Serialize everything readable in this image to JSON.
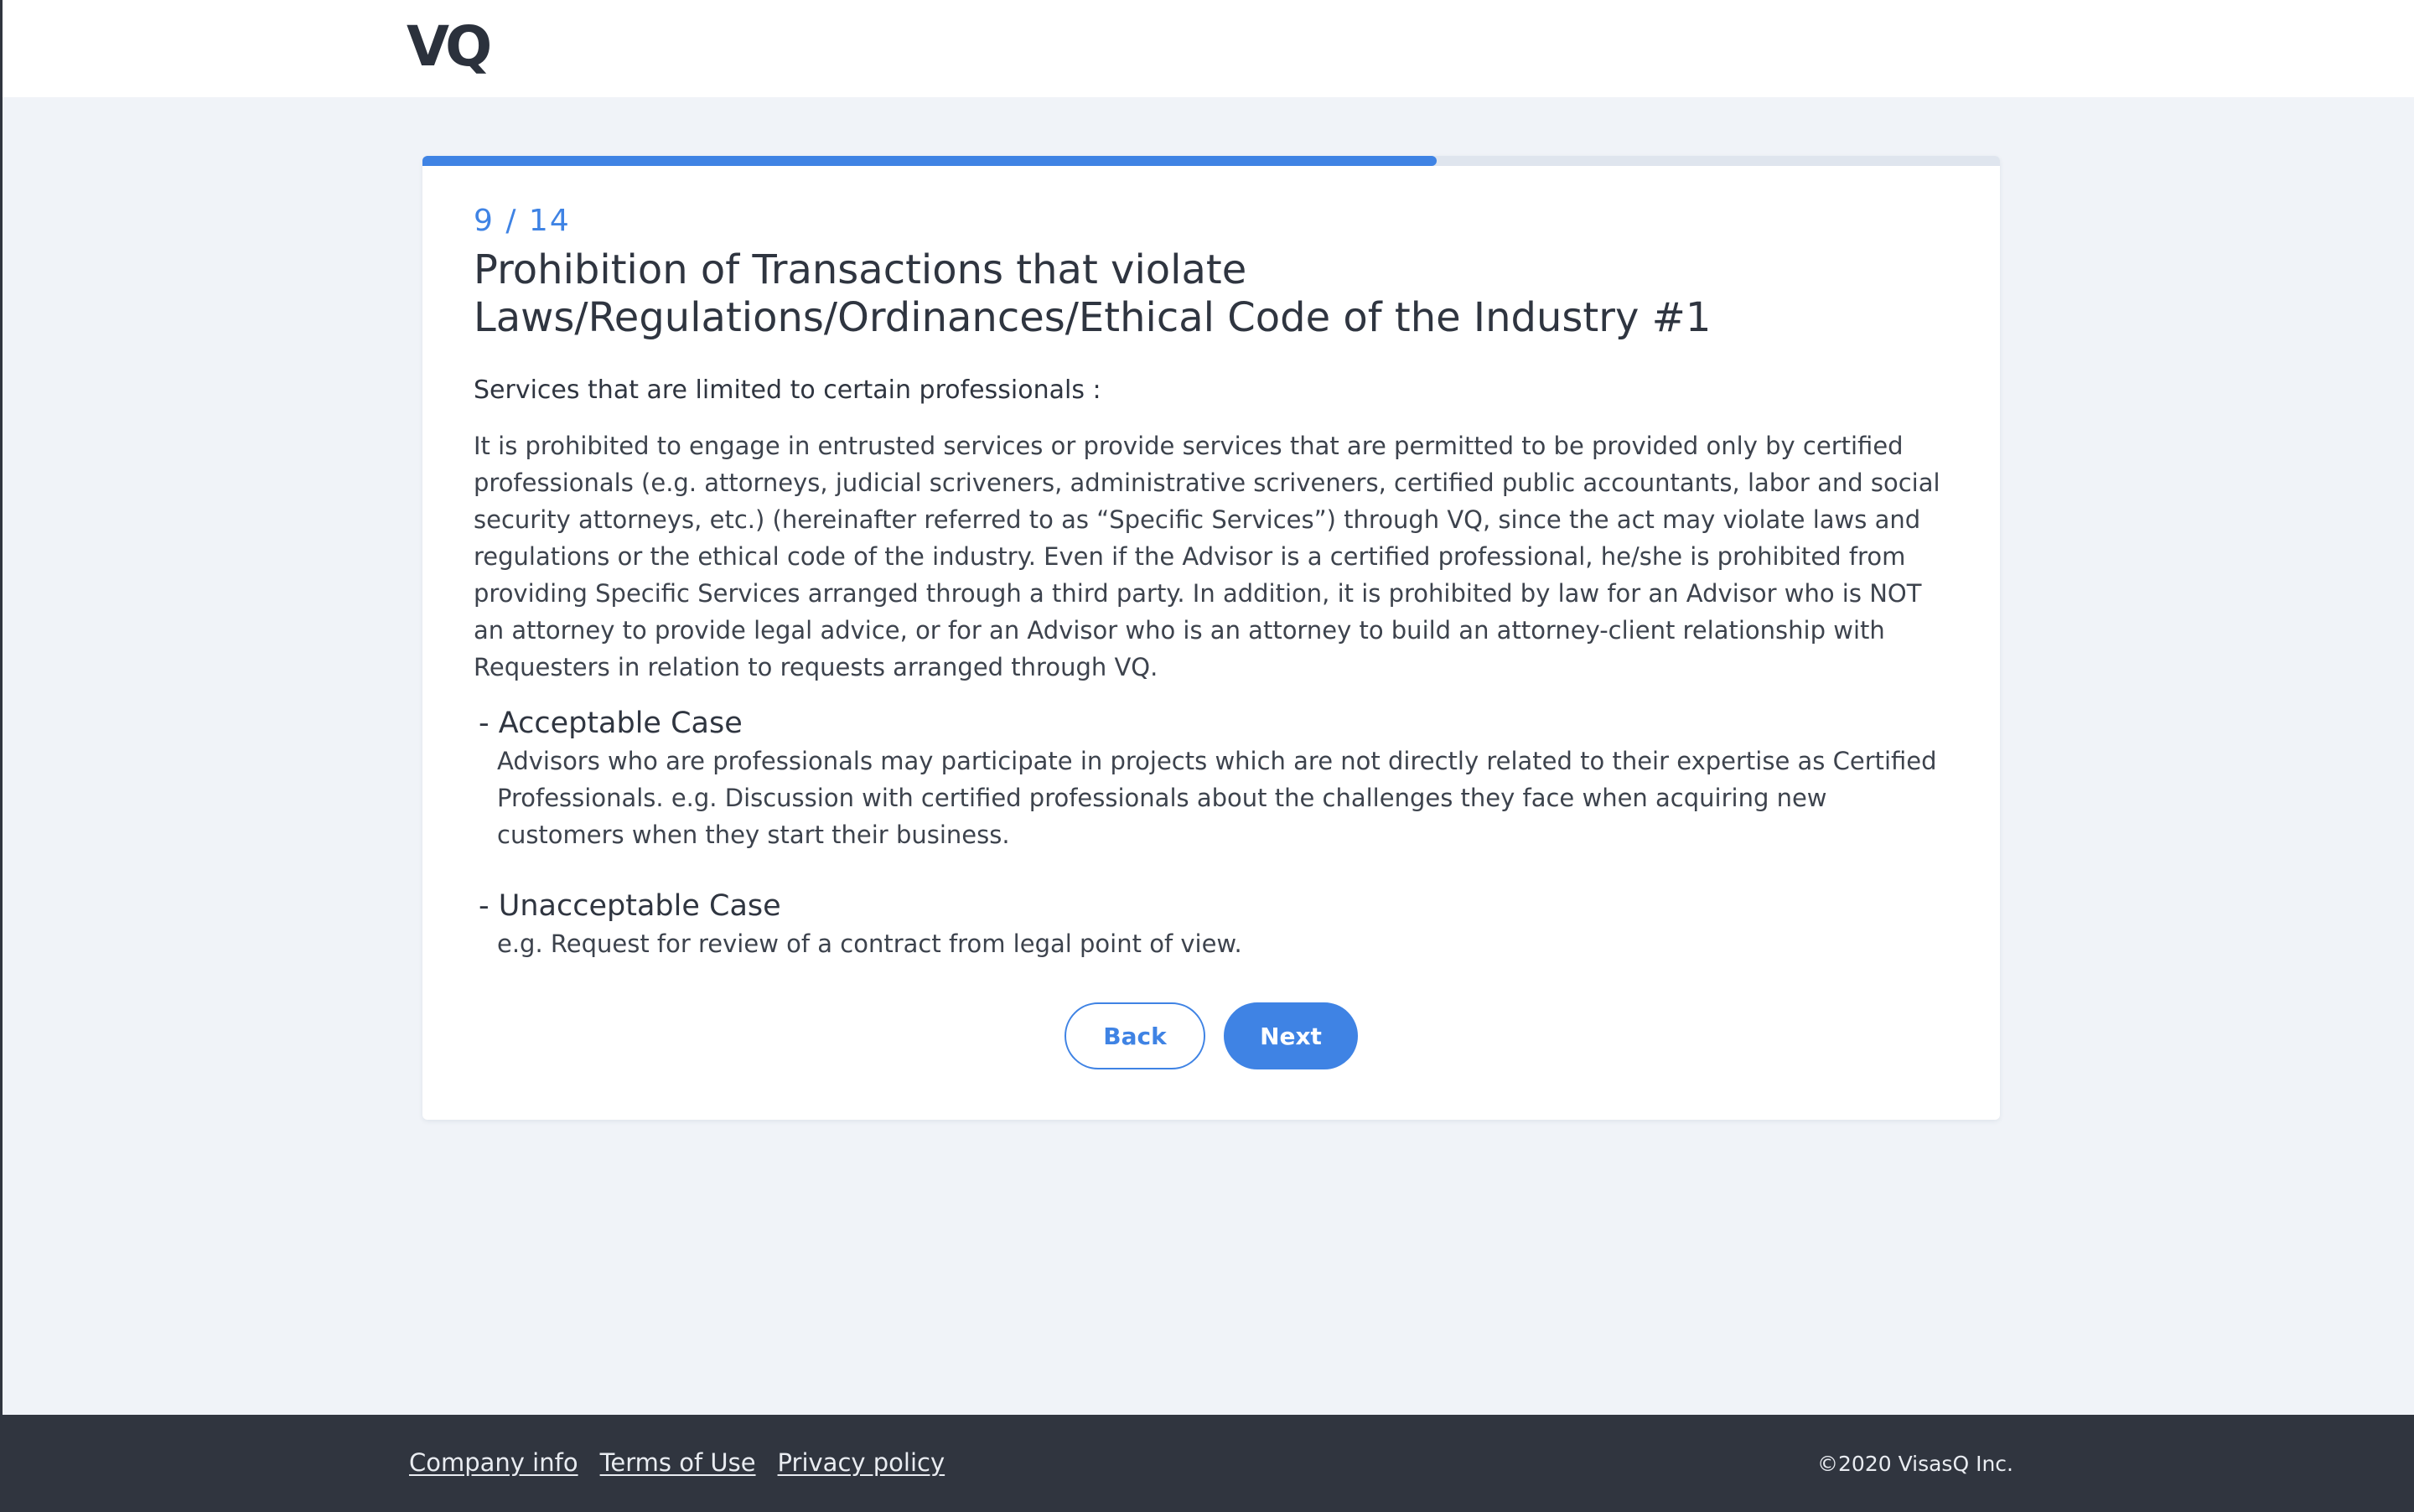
{
  "header": {
    "logo_text": "VQ"
  },
  "progress": {
    "current": 9,
    "total": 14,
    "label": "9 / 14",
    "fraction": 0.643
  },
  "question": {
    "title": "Prohibition of Transactions that violate Laws/Regulations/Ordinances/Ethical Code of the Industry #1",
    "section_heading": "Services that are limited to certain professionals :",
    "body": "It is prohibited to engage in entrusted services or provide services that are permitted to be provided only by certified professionals (e.g. attorneys, judicial scriveners, administrative scriveners, certified public accountants, labor and social security attorneys, etc.) (hereinafter referred to as “Specific Services”) through VQ, since the act may violate laws and regulations or the ethical code of the industry. Even if the Advisor is a certified professional, he/she is prohibited from providing Specific Services arranged through a third party. In addition, it is prohibited by law for an Advisor who is NOT an attorney to provide legal advice, or for an Advisor who is an attorney to build an attorney-client relationship with Requesters in relation to requests arranged through VQ.",
    "cases": [
      {
        "heading": "- Acceptable Case",
        "text": "Advisors who are professionals may participate in projects which are not directly related to their expertise as Certified Professionals. e.g. Discussion with certified professionals about the challenges they face when acquiring new customers when they start their business."
      },
      {
        "heading": "- Unacceptable Case",
        "text": "e.g. Request for review of a contract from legal point of view."
      }
    ]
  },
  "actions": {
    "back_label": "Back",
    "next_label": "Next"
  },
  "footer": {
    "links": [
      "Company info",
      "Terms of Use",
      "Privacy policy"
    ],
    "copyright": "©2020 VisasQ Inc."
  },
  "colors": {
    "accent": "#3f83e4",
    "footer_bg": "#30353f",
    "page_bg": "#f0f3f8"
  }
}
